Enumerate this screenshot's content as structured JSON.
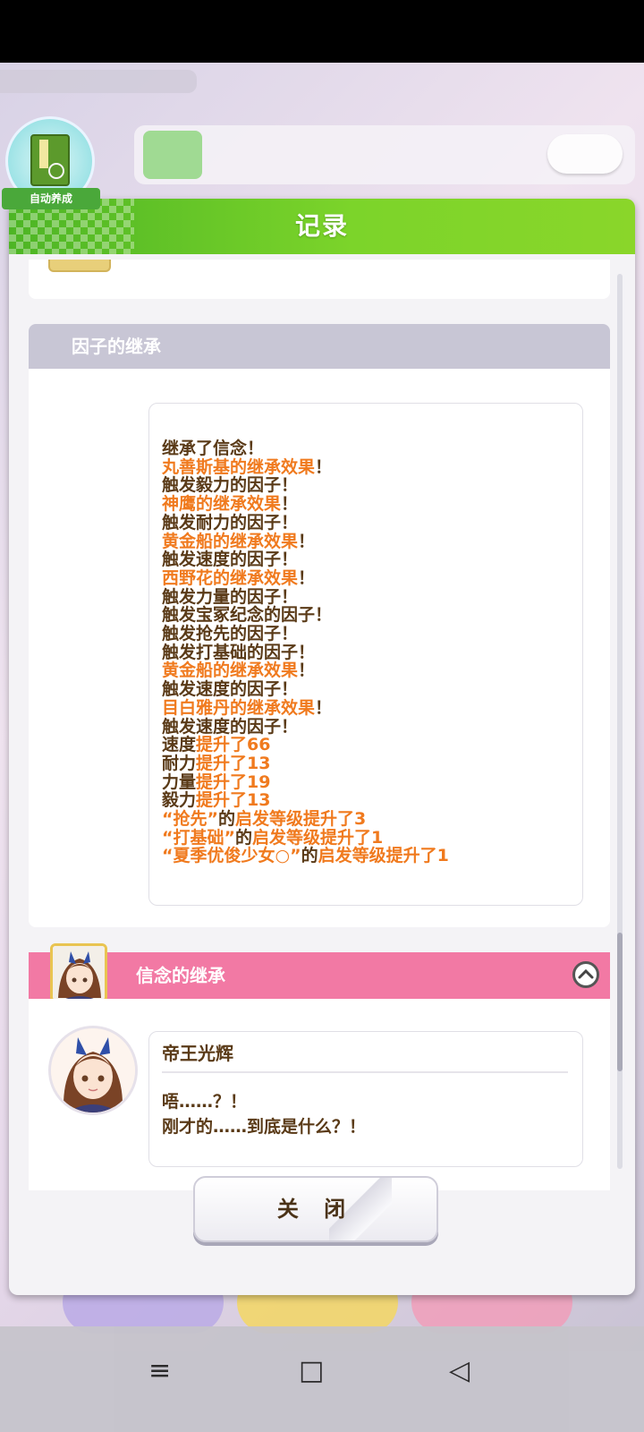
{
  "dialog": {
    "title": "记录",
    "close_label": "关 闭"
  },
  "auto_badge": {
    "label": "自动养成"
  },
  "inheritance": {
    "title": "因子的继承",
    "lines": [
      [
        {
          "t": "继承了信念！",
          "c": "b"
        }
      ],
      [
        {
          "t": "丸善斯基的继承效果",
          "c": "o"
        },
        {
          "t": "！",
          "c": "b"
        }
      ],
      [
        {
          "t": "触发毅力的因子！",
          "c": "b"
        }
      ],
      [
        {
          "t": "神鹰的继承效果",
          "c": "o"
        },
        {
          "t": "！",
          "c": "b"
        }
      ],
      [
        {
          "t": "触发耐力的因子！",
          "c": "b"
        }
      ],
      [
        {
          "t": "黄金船的继承效果",
          "c": "o"
        },
        {
          "t": "！",
          "c": "b"
        }
      ],
      [
        {
          "t": "触发速度的因子！",
          "c": "b"
        }
      ],
      [
        {
          "t": "西野花的继承效果",
          "c": "o"
        },
        {
          "t": "！",
          "c": "b"
        }
      ],
      [
        {
          "t": "触发力量的因子！",
          "c": "b"
        }
      ],
      [
        {
          "t": "触发宝冢纪念的因子！",
          "c": "b"
        }
      ],
      [
        {
          "t": "触发抢先的因子！",
          "c": "b"
        }
      ],
      [
        {
          "t": "触发打基础的因子！",
          "c": "b"
        }
      ],
      [
        {
          "t": "黄金船的继承效果",
          "c": "o"
        },
        {
          "t": "！",
          "c": "b"
        }
      ],
      [
        {
          "t": "触发速度的因子！",
          "c": "b"
        }
      ],
      [
        {
          "t": "目白雅丹的继承效果",
          "c": "o"
        },
        {
          "t": "！",
          "c": "b"
        }
      ],
      [
        {
          "t": "触发速度的因子！",
          "c": "b"
        }
      ],
      [
        {
          "t": "速度",
          "c": "b"
        },
        {
          "t": "提升了66",
          "c": "o"
        }
      ],
      [
        {
          "t": "耐力",
          "c": "b"
        },
        {
          "t": "提升了13",
          "c": "o"
        }
      ],
      [
        {
          "t": "力量",
          "c": "b"
        },
        {
          "t": "提升了19",
          "c": "o"
        }
      ],
      [
        {
          "t": "毅力",
          "c": "b"
        },
        {
          "t": "提升了13",
          "c": "o"
        }
      ],
      [
        {
          "t": "“抢先”",
          "c": "o"
        },
        {
          "t": "的",
          "c": "b"
        },
        {
          "t": "启发等级提升了3",
          "c": "o"
        }
      ],
      [
        {
          "t": "“打基础”",
          "c": "o"
        },
        {
          "t": "的",
          "c": "b"
        },
        {
          "t": "启发等级提升了1",
          "c": "o"
        }
      ],
      [
        {
          "t": "“夏季优俊少女○”",
          "c": "o"
        },
        {
          "t": "的",
          "c": "b"
        },
        {
          "t": "启发等级提升了1",
          "c": "o"
        }
      ]
    ]
  },
  "event": {
    "title": "信念的继承",
    "speaker": "帝王光辉",
    "text": "唔……？！\n刚才的……到底是什么？！"
  },
  "colors": {
    "header_green": "#7cd42a",
    "section_gray": "#c8c6d5",
    "event_pink": "#f279a4",
    "text_brown": "#5a3a17",
    "text_orange": "#f07a1e"
  },
  "navbar": {
    "menu_icon": "≡",
    "home_icon": "□",
    "back_icon": "◁"
  }
}
